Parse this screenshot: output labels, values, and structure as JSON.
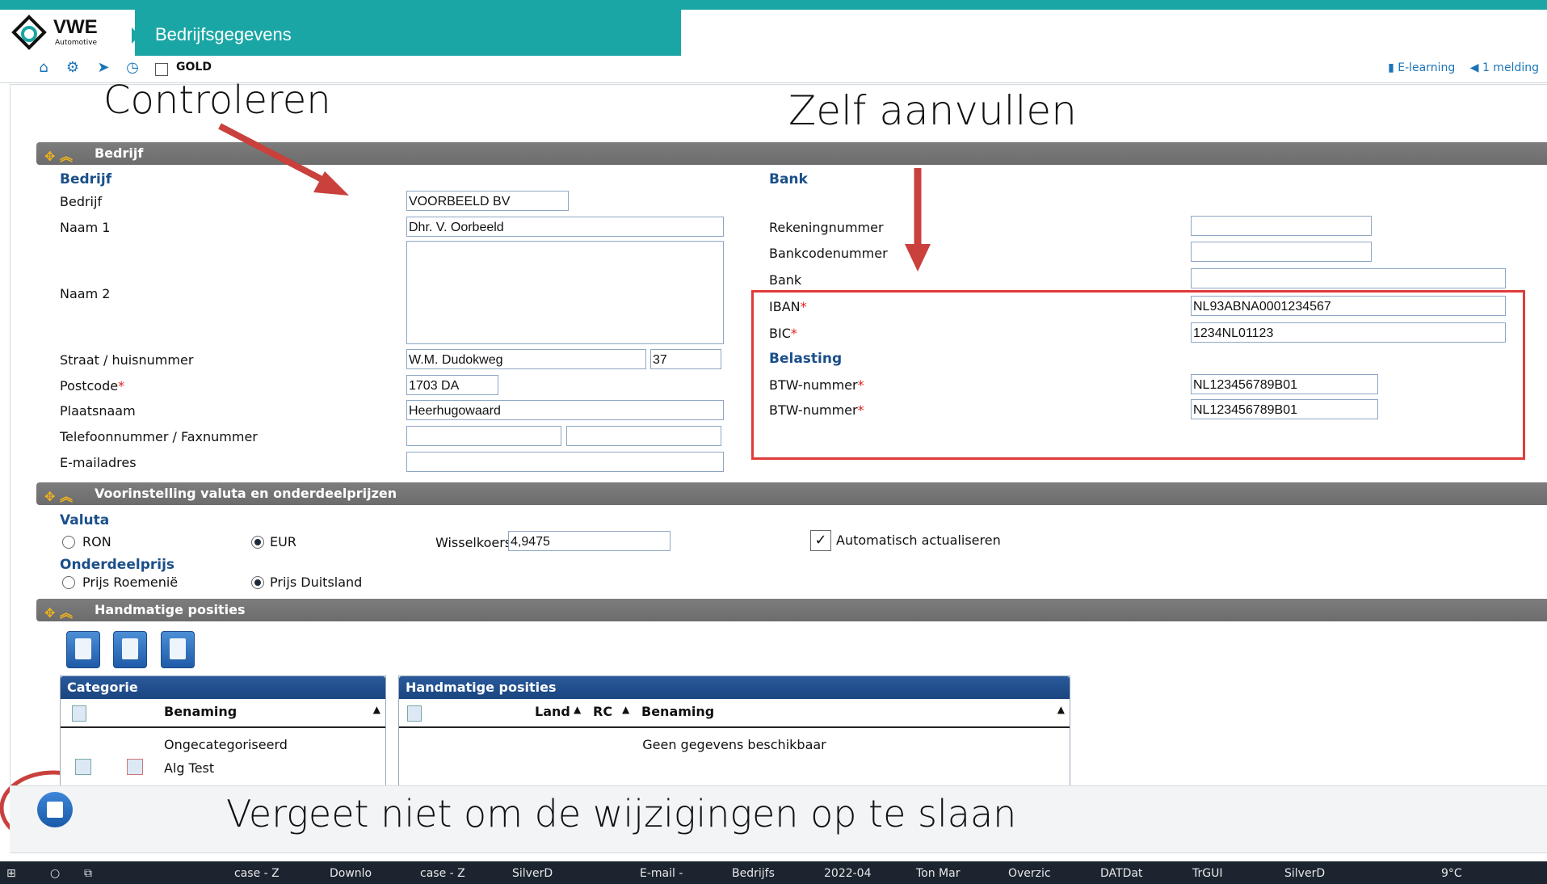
{
  "app": {
    "logo_text": "VWE",
    "logo_sub": "Automotive",
    "page_title": "Bedrijfsgegevens"
  },
  "toolbar": {
    "gold_label": "GOLD",
    "elearning": "E-learning",
    "melding": "1 melding"
  },
  "annotations": {
    "controleren": "Controleren",
    "zelf_aanvullen": "Zelf aanvullen",
    "vergeet": "Vergeet niet om de wijzigingen op te slaan"
  },
  "bedrijf_section": {
    "title": "Bedrijf",
    "group_bedrijf": "Bedrijf",
    "fields": {
      "bedrijf": {
        "label": "Bedrijf",
        "value": "VOORBEELD BV"
      },
      "naam1": {
        "label": "Naam 1",
        "value": "Dhr. V. Oorbeeld"
      },
      "naam2": {
        "label": "Naam 2",
        "value": ""
      },
      "straat": {
        "label": "Straat / huisnummer",
        "value": "W.M. Dudokweg",
        "huisnummer": "37"
      },
      "postcode": {
        "label": "Postcode",
        "value": "1703 DA"
      },
      "plaatsnaam": {
        "label": "Plaatsnaam",
        "value": "Heerhugowaard"
      },
      "telefoon": {
        "label": "Telefoonnummer / Faxnummer",
        "value": "",
        "fax": ""
      },
      "email": {
        "label": "E-mailadres",
        "value": ""
      }
    },
    "group_bank": "Bank",
    "bank_fields": {
      "rekeningnummer": {
        "label": "Rekeningnummer",
        "value": ""
      },
      "bankcodenummer": {
        "label": "Bankcodenummer",
        "value": ""
      },
      "bank": {
        "label": "Bank",
        "value": ""
      },
      "iban": {
        "label": "IBAN",
        "value": "NL93ABNA0001234567"
      },
      "bic": {
        "label": "BIC",
        "value": "1234NL01123"
      }
    },
    "group_belasting": "Belasting",
    "belasting_fields": [
      {
        "label": "BTW-nummer",
        "value": "NL123456789B01"
      },
      {
        "label": "BTW-nummer",
        "value": "NL123456789B01"
      }
    ],
    "required_mark": "*"
  },
  "valuta_section": {
    "title": "Voorinstelling valuta en onderdeelprijzen",
    "valuta_label": "Valuta",
    "valuta_options": [
      {
        "label": "RON",
        "selected": false
      },
      {
        "label": "EUR",
        "selected": true
      }
    ],
    "wisselkoers_label": "Wisselkoers",
    "wisselkoers_value": "4,9475",
    "auto_update_label": "Automatisch actualiseren",
    "auto_update_checked": true,
    "onderdeelprijs_label": "Onderdeelprijs",
    "prijs_options": [
      {
        "label": "Prijs Roemenië",
        "selected": false
      },
      {
        "label": "Prijs Duitsland",
        "selected": true
      }
    ]
  },
  "handmatig_section": {
    "title": "Handmatige posities",
    "categorie_grid": {
      "title": "Categorie",
      "col_benaming": "Benaming",
      "rows": [
        "Ongecategoriseerd",
        "Alg Test"
      ]
    },
    "posities_grid": {
      "title": "Handmatige posities",
      "col_land": "Land",
      "col_rc": "RC",
      "col_benaming": "Benaming",
      "empty": "Geen gegevens beschikbaar"
    }
  },
  "taskbar": {
    "items": [
      "case - Z",
      "Downlo",
      "case - Z",
      "SilverD",
      "E-mail -",
      "Bedrijfs",
      "2022-04",
      "Ton Mar",
      "Overzic",
      "DATDat",
      "TrGUI",
      "SilverD",
      "9°C"
    ]
  },
  "colors": {
    "teal": "#1aa6a5",
    "navy": "#1b4f8a",
    "annotation_red": "#c0392b"
  }
}
